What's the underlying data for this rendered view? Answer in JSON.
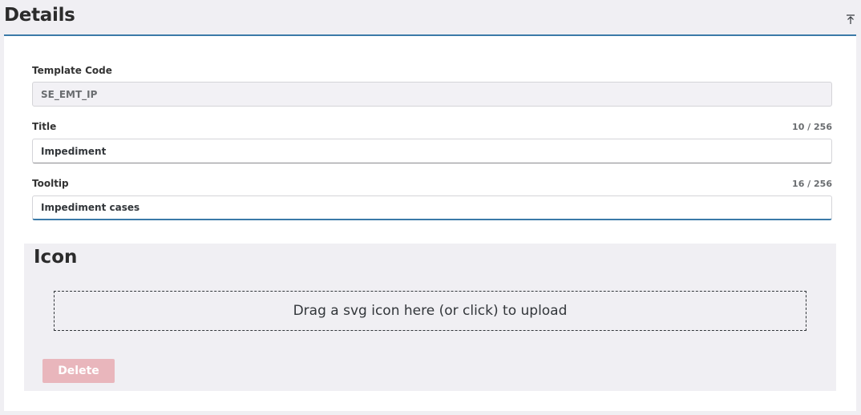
{
  "header": {
    "title": "Details",
    "collapse_icon": "collapse-top-icon"
  },
  "form": {
    "template_code": {
      "label": "Template Code",
      "value": "SE_EMT_IP"
    },
    "title": {
      "label": "Title",
      "counter": "10 / 256",
      "value": "Impediment"
    },
    "tooltip": {
      "label": "Tooltip",
      "counter": "16 / 256",
      "value": "Impediment cases"
    }
  },
  "icon_section": {
    "title": "Icon",
    "dropzone_text": "Drag a svg icon here (or click) to upload",
    "delete_label": "Delete"
  },
  "colors": {
    "accent": "#3b7aa8",
    "delete_disabled": "#e9b6bc",
    "section_bg": "#f0eff3"
  }
}
